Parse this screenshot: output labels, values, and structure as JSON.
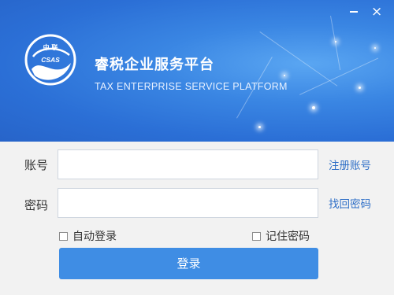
{
  "window": {
    "minimize_icon": "minimize-icon",
    "close_icon": "close-icon",
    "close_glyph": "×"
  },
  "header": {
    "logo_top_text": "中 联",
    "logo_mid_text": "CSAS",
    "title": "睿税企业服务平台",
    "subtitle": "TAX ENTERPRISE SERVICE PLATFORM"
  },
  "form": {
    "account_label": "账号",
    "account_value": "",
    "password_label": "密码",
    "password_value": "",
    "register_link": "注册账号",
    "recover_link": "找回密码",
    "auto_login_label": "自动登录",
    "auto_login_checked": false,
    "remember_label": "记住密码",
    "remember_checked": false,
    "login_button": "登录"
  },
  "colors": {
    "banner": "#2b6fd6",
    "accent": "#3f8de4",
    "link": "#2f6fc7"
  }
}
